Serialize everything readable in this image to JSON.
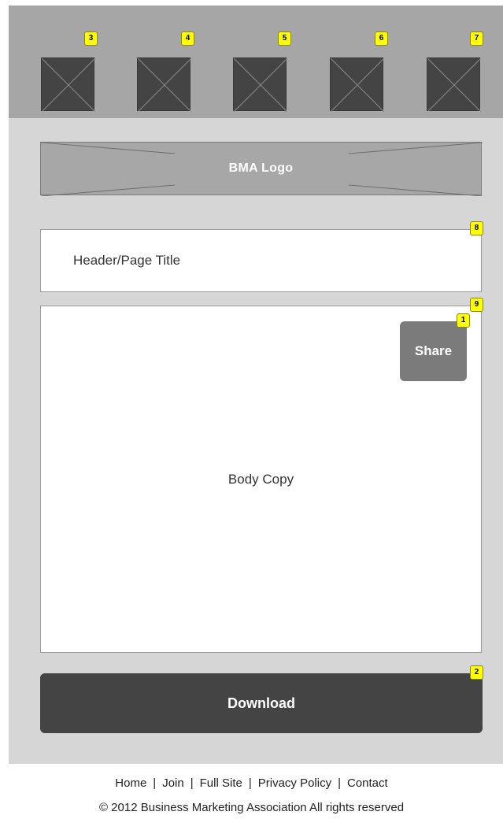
{
  "nav_thumbnails": [
    {
      "badge": "3",
      "icon": "image-placeholder-icon"
    },
    {
      "badge": "4",
      "icon": "image-placeholder-icon"
    },
    {
      "badge": "5",
      "icon": "image-placeholder-icon"
    },
    {
      "badge": "6",
      "icon": "image-placeholder-icon"
    },
    {
      "badge": "7",
      "icon": "image-placeholder-icon"
    }
  ],
  "logo": {
    "label": "BMA Logo"
  },
  "page_title": {
    "label": "Header/Page Title",
    "badge": "8"
  },
  "body_copy": {
    "label": "Body Copy",
    "badge": "9"
  },
  "share": {
    "label": "Share",
    "badge": "1"
  },
  "download": {
    "label": "Download",
    "badge": "2"
  },
  "footer": {
    "links": [
      "Home",
      "Join",
      "Full Site",
      "Privacy Policy",
      "Contact"
    ],
    "separator": "|",
    "copyright": "© 2012 Business Marketing Association All rights reserved"
  },
  "colors": {
    "frame": "#d6d6d6",
    "topbar": "#a6a6a6",
    "dark": "#444444",
    "share": "#7b7b7b",
    "badge": "#ffff00"
  }
}
